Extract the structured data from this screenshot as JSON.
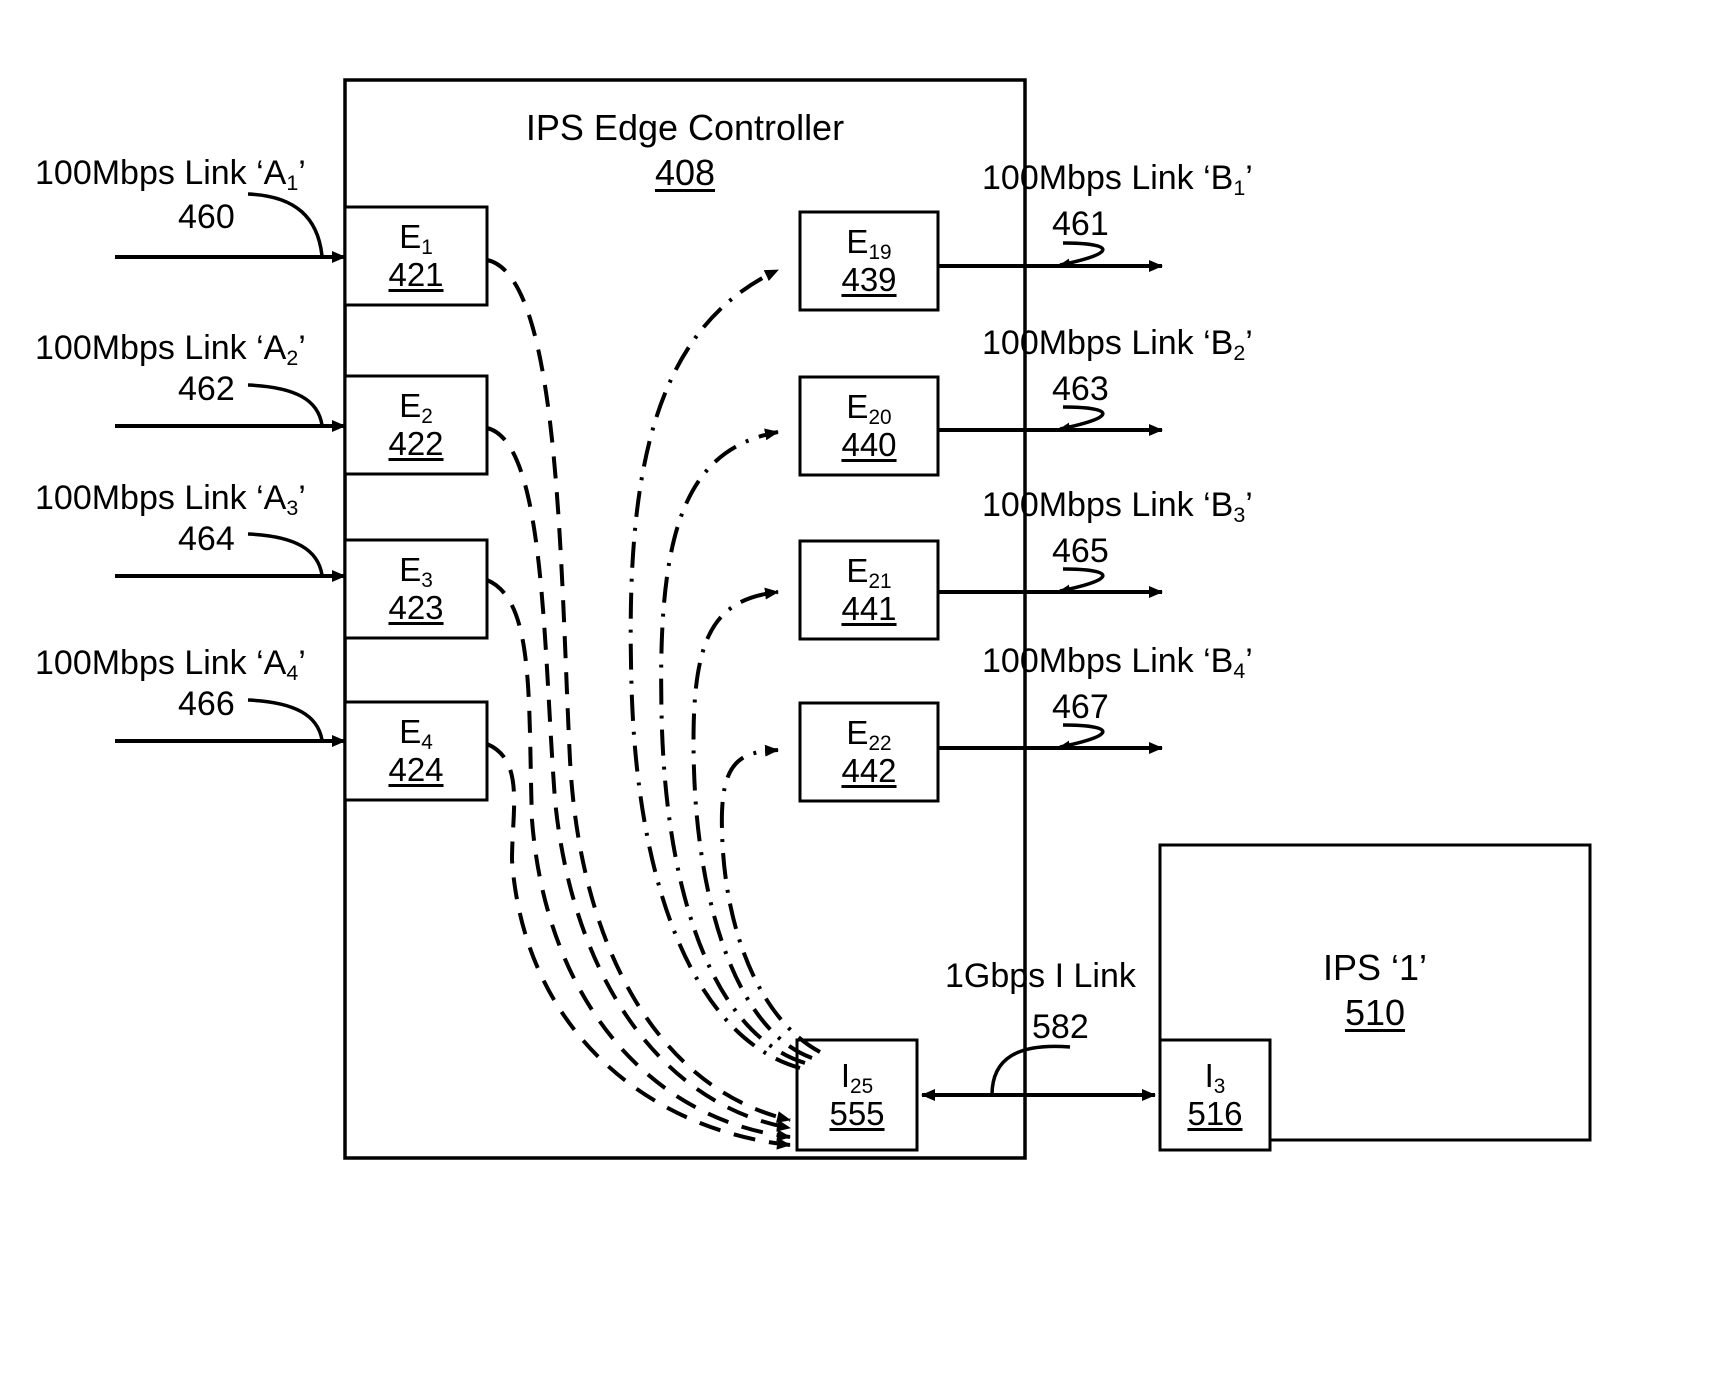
{
  "diagram": {
    "controller": {
      "title": "IPS Edge Controller",
      "ref": "408"
    },
    "ips": {
      "title": "IPS ‘1’",
      "ref": "510"
    },
    "ingress_ports": [
      {
        "name": "E",
        "sub": "1",
        "ref": "421"
      },
      {
        "name": "E",
        "sub": "2",
        "ref": "422"
      },
      {
        "name": "E",
        "sub": "3",
        "ref": "423"
      },
      {
        "name": "E",
        "sub": "4",
        "ref": "424"
      }
    ],
    "egress_ports": [
      {
        "name": "E",
        "sub": "19",
        "ref": "439"
      },
      {
        "name": "E",
        "sub": "20",
        "ref": "440"
      },
      {
        "name": "E",
        "sub": "21",
        "ref": "441"
      },
      {
        "name": "E",
        "sub": "22",
        "ref": "442"
      }
    ],
    "interconnect_ports": [
      {
        "name": "I",
        "sub": "25",
        "ref": "555"
      },
      {
        "name": "I",
        "sub": "3",
        "ref": "516"
      }
    ],
    "left_links": [
      {
        "label": "100Mbps Link ‘A",
        "sub": "1",
        "label_end": "’",
        "ref": "460"
      },
      {
        "label": "100Mbps Link ‘A",
        "sub": "2",
        "label_end": "’",
        "ref": "462"
      },
      {
        "label": "100Mbps Link ‘A",
        "sub": "3",
        "label_end": "’",
        "ref": "464"
      },
      {
        "label": "100Mbps Link ‘A",
        "sub": "4",
        "label_end": "’",
        "ref": "466"
      }
    ],
    "right_links": [
      {
        "label": "100Mbps Link ‘B",
        "sub": "1",
        "label_end": "’",
        "ref": "461"
      },
      {
        "label": "100Mbps Link ‘B",
        "sub": "2",
        "label_end": "’",
        "ref": "463"
      },
      {
        "label": "100Mbps Link ‘B",
        "sub": "3",
        "label_end": "’",
        "ref": "465"
      },
      {
        "label": "100Mbps Link ‘B",
        "sub": "4",
        "label_end": "’",
        "ref": "467"
      }
    ],
    "interconnect_link": {
      "label": "1Gbps I Link",
      "ref": "582"
    },
    "colors": {
      "stroke": "#000000",
      "background": "#ffffff"
    }
  }
}
